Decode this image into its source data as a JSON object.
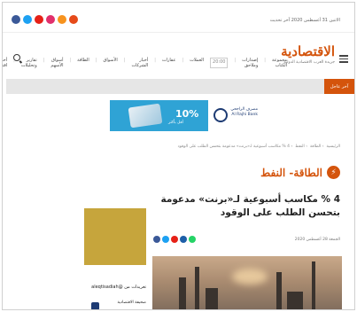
{
  "topbar": {
    "date_text": "الاثنين 31 أغسطس 2020 آخر تحديث",
    "social_icons": [
      {
        "name": "facebook-icon",
        "color": "#3b5998"
      },
      {
        "name": "twitter-icon",
        "color": "#1da1f2"
      },
      {
        "name": "youtube-icon",
        "color": "#e62117"
      },
      {
        "name": "instagram-icon",
        "color": "#e1306c"
      },
      {
        "name": "rss-icon",
        "color": "#f7931e"
      },
      {
        "name": "linkedin-icon",
        "color": "#e64a19"
      }
    ]
  },
  "header": {
    "logo_name": "الاقتصادية",
    "logo_tagline": "جريدة العرب الاقتصادية الدولية",
    "nav_items": [
      "أخبار اقتصادية",
      "تقارير وتحليلات",
      "أسواق الأسهم",
      "الطاقة",
      "الأسواق",
      "أخبار الشركات",
      "عقارات",
      "العملات",
      "إصدارات وملاحق",
      "مجموعة الكتاب"
    ],
    "nav_box_label": "20:00"
  },
  "breaking": {
    "label": "آخر عاجل"
  },
  "banner": {
    "percent": "10%",
    "subtitle": "أقل بأكثر",
    "bank_line1": "مصرف الراجحي",
    "bank_line2": "Al Rajhi Bank"
  },
  "breadcrumb": {
    "items": [
      "الرئيسية",
      "الطاقة",
      "النفط",
      "4 % مكاسب أسبوعية لـ«برنت» مدعومة بتحسن الطلب على الوقود"
    ]
  },
  "section": {
    "title": "الطاقة- النفط"
  },
  "article": {
    "headline": "4 % مكاسب أسبوعية لـ«برنت» مدعومة بتحسن الطلب على الوقود",
    "date": "الجمعة 28 أغسطس 2020",
    "share_icons": [
      {
        "name": "facebook-icon",
        "color": "#3b5998"
      },
      {
        "name": "twitter-icon",
        "color": "#1da1f2"
      },
      {
        "name": "email-icon",
        "color": "#e62117"
      },
      {
        "name": "print-icon",
        "color": "#1d5fa8"
      },
      {
        "name": "whatsapp-icon",
        "color": "#25d366"
      }
    ]
  },
  "sidebar": {
    "tweets_label": "تغريدات من",
    "handle": "@aleqtisadiah",
    "account_name": "صحيفة الاقتصادية"
  }
}
